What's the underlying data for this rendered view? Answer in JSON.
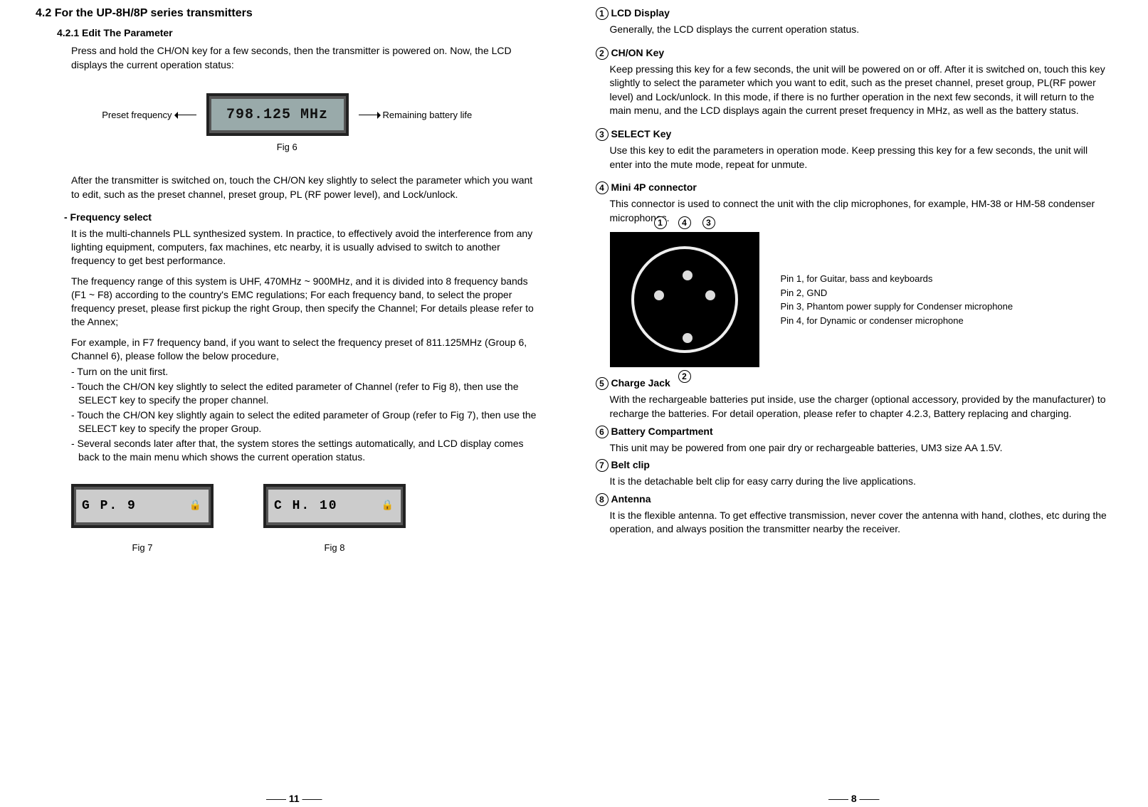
{
  "left": {
    "h2": "4.2 For the UP-8H/8P series transmitters",
    "h3": "4.2.1 Edit The Parameter",
    "intro": "Press and hold the CH/ON key for a few seconds, then the transmitter is powered on. Now, the LCD displays the current operation status:",
    "fig6": {
      "left_label": "Preset frequency",
      "lcd_text": "798.125 MHz",
      "right_label": "Remaining battery life",
      "caption": "Fig 6"
    },
    "after_on": "After the transmitter is switched on, touch the CH/ON  key slightly to select the parameter which you want to edit, such as the preset channel, preset group, PL (RF power level), and Lock/unlock.",
    "freq_title": "-  Frequency select",
    "freq_p1": "It is the multi-channels PLL synthesized system. In practice, to effectively avoid the interference from any lighting equipment, computers, fax machines, etc nearby, it is usually advised to switch to another frequency to get best performance.",
    "freq_p2": "The frequency range of this system is UHF, 470MHz ~ 900MHz, and it is divided into 8 frequency bands (F1 ~ F8) according to the country's EMC regulations; For each frequency band, to select the proper frequency preset, please first pickup the right Group, then specify the Channel; For details please refer to the Annex;",
    "freq_p3": "For example, in F7 frequency band, if you want to select the frequency preset of 811.125MHz (Group 6, Channel 6),   please follow the below procedure,",
    "proc": [
      "- Turn on the unit first.",
      "- Touch the CH/ON key slightly to select the edited parameter of Channel (refer to Fig 8), then use the SELECT key to specify the proper channel.",
      "- Touch the CH/ON key slightly again to select the edited parameter of Group (refer to Fig 7), then use  the SELECT key to specify the proper Group.",
      "- Several seconds later after that, the system stores the settings automatically, and LCD display comes back to the main menu which shows the current operation status."
    ],
    "fig7": {
      "lcd": "G  P.   9",
      "caption": "Fig 7"
    },
    "fig8": {
      "lcd": "C  H.  10",
      "caption": "Fig 8"
    },
    "page_num": "11"
  },
  "right": {
    "items": [
      {
        "num": "1",
        "title": "LCD Display",
        "body": "Generally, the LCD displays the current operation status."
      },
      {
        "num": "2",
        "title": "CH/ON Key",
        "body": "Keep pressing this key for a few seconds, the unit will be powered on or off. After it is switched on, touch this key slightly to select the parameter which you want to edit, such as the preset channel, preset group, PL(RF power  level) and Lock/unlock. In this mode, if there is no further operation in the next few seconds, it will return to the main menu, and the LCD displays again the current preset frequency in MHz, as well as the battery status."
      },
      {
        "num": "3",
        "title": "SELECT Key",
        "body": "Use this key to edit the parameters in operation mode. Keep pressing this key for a few seconds, the unit will enter into the mute mode, repeat for unmute."
      },
      {
        "num": "4",
        "title": "Mini 4P connector",
        "body": "This connector is used to connect the unit with the clip microphones, for example, HM-38 or HM-58 condenser microphones."
      }
    ],
    "pins": {
      "p1": "Pin 1, for Guitar, bass and keyboards",
      "p2": "Pin 2, GND",
      "p3": "Pin 3, Phantom power supply for Condenser microphone",
      "p4": "Pin 4, for Dynamic or condenser microphone"
    },
    "callout_nums": {
      "tl": "1",
      "tm": "4",
      "tr": "3",
      "bot": "2"
    },
    "items2": [
      {
        "num": "5",
        "title": "Charge Jack",
        "body": "With the rechargeable batteries put inside, use the charger (optional accessory, provided by the manufacturer) to recharge the batteries. For detail operation, please refer to chapter 4.2.3, Battery replacing and charging."
      },
      {
        "num": "6",
        "title": "Battery Compartment",
        "body": "This unit may be powered from one pair dry or rechargeable batteries, UM3 size AA 1.5V."
      },
      {
        "num": "7",
        "title": "Belt clip",
        "body": "It is the detachable belt clip for easy carry during the live applications."
      },
      {
        "num": "8",
        "title": "Antenna",
        "body": "It is the flexible antenna. To get effective transmission, never cover the antenna with hand, clothes, etc during the operation, and always position the transmitter nearby the receiver."
      }
    ],
    "page_num": "8"
  }
}
